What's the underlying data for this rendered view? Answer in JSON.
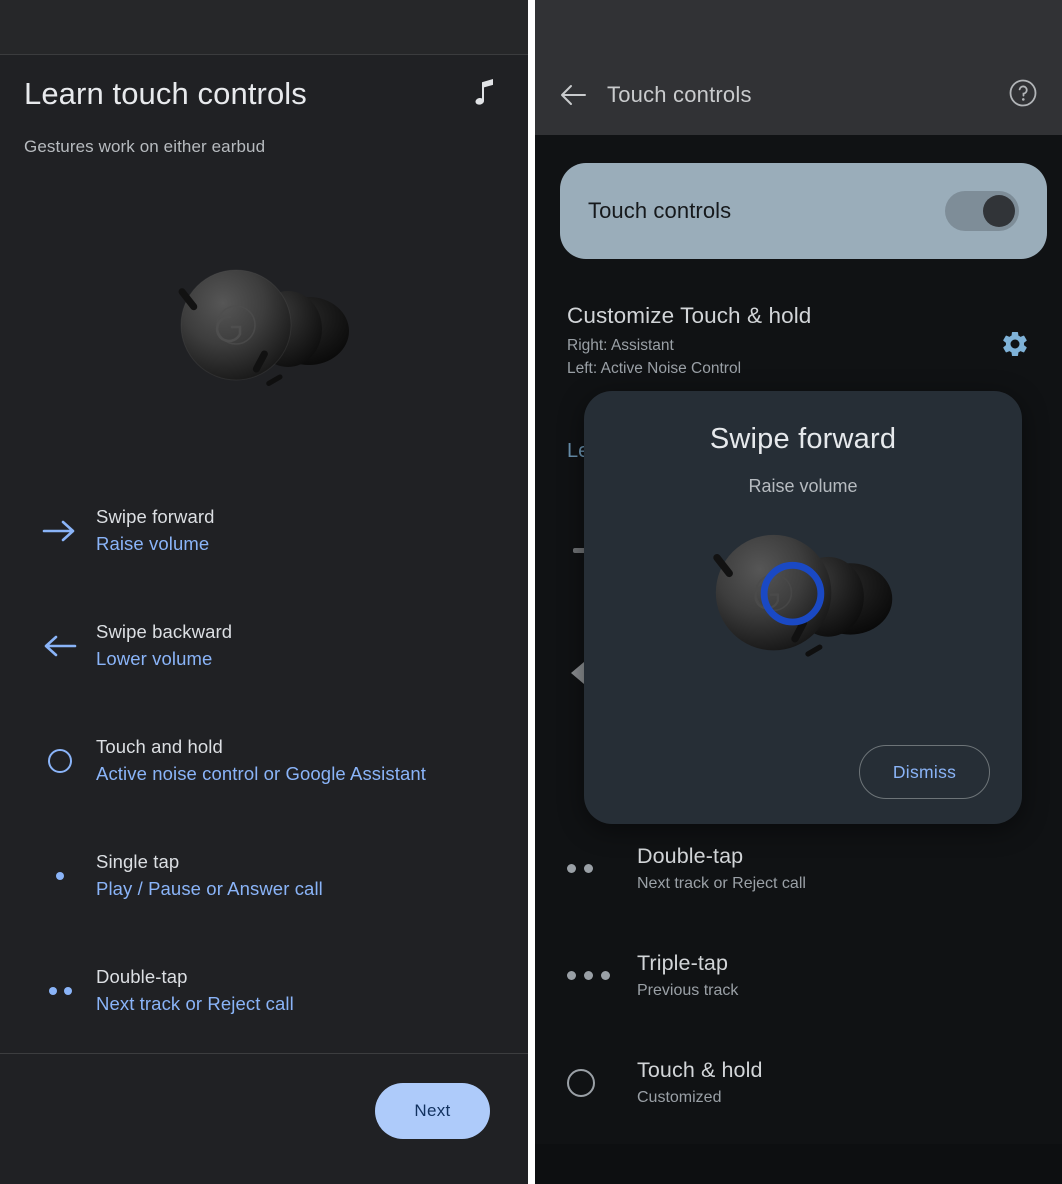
{
  "left": {
    "title": "Learn touch controls",
    "music_icon": "music-note-icon",
    "subtitle": "Gestures work on either earbud",
    "earbud_alt": "pixel-buds-pro-earbud",
    "gestures": [
      {
        "icon": "arrow-right-icon",
        "title": "Swipe forward",
        "action": "Raise volume"
      },
      {
        "icon": "arrow-left-icon",
        "title": "Swipe backward",
        "action": "Lower volume"
      },
      {
        "icon": "circle-outline-icon",
        "title": "Touch and hold",
        "action": "Active noise control or Google Assistant"
      },
      {
        "icon": "one-dot-icon",
        "title": "Single tap",
        "action": "Play / Pause or Answer call"
      },
      {
        "icon": "two-dots-icon",
        "title": "Double-tap",
        "action": "Next track or Reject call"
      }
    ],
    "next_label": "Next"
  },
  "right": {
    "appbar": {
      "back_icon": "back-arrow-icon",
      "title": "Touch controls",
      "help_icon": "help-circle-icon"
    },
    "toggle_card": {
      "label": "Touch controls",
      "state": "on"
    },
    "customize": {
      "title": "Customize Touch & hold",
      "right_line": "Right: Assistant",
      "left_line": "Left: Active Noise Control",
      "gear_icon": "gear-icon"
    },
    "obscured_link": "Le",
    "list": [
      {
        "icon": "two-dots-icon",
        "title": "Double-tap",
        "sub": "Next track or Reject call"
      },
      {
        "icon": "three-dots-icon",
        "title": "Triple-tap",
        "sub": "Previous track"
      },
      {
        "icon": "circle-outline-icon",
        "title": "Touch & hold",
        "sub": "Customized"
      }
    ]
  },
  "dialog": {
    "title": "Swipe forward",
    "subtitle": "Raise volume",
    "earbud_alt": "pixel-buds-pro-earbud-with-gesture-ring",
    "dismiss_label": "Dismiss"
  },
  "colors": {
    "accent_blue": "#8ab4f8",
    "next_button_bg": "#aecbfa",
    "toggle_card_bg": "#9aadba",
    "dialog_bg": "#262e36",
    "gesture_ring_blue": "#1a49c4",
    "gear_blue": "#7fb2d8"
  }
}
